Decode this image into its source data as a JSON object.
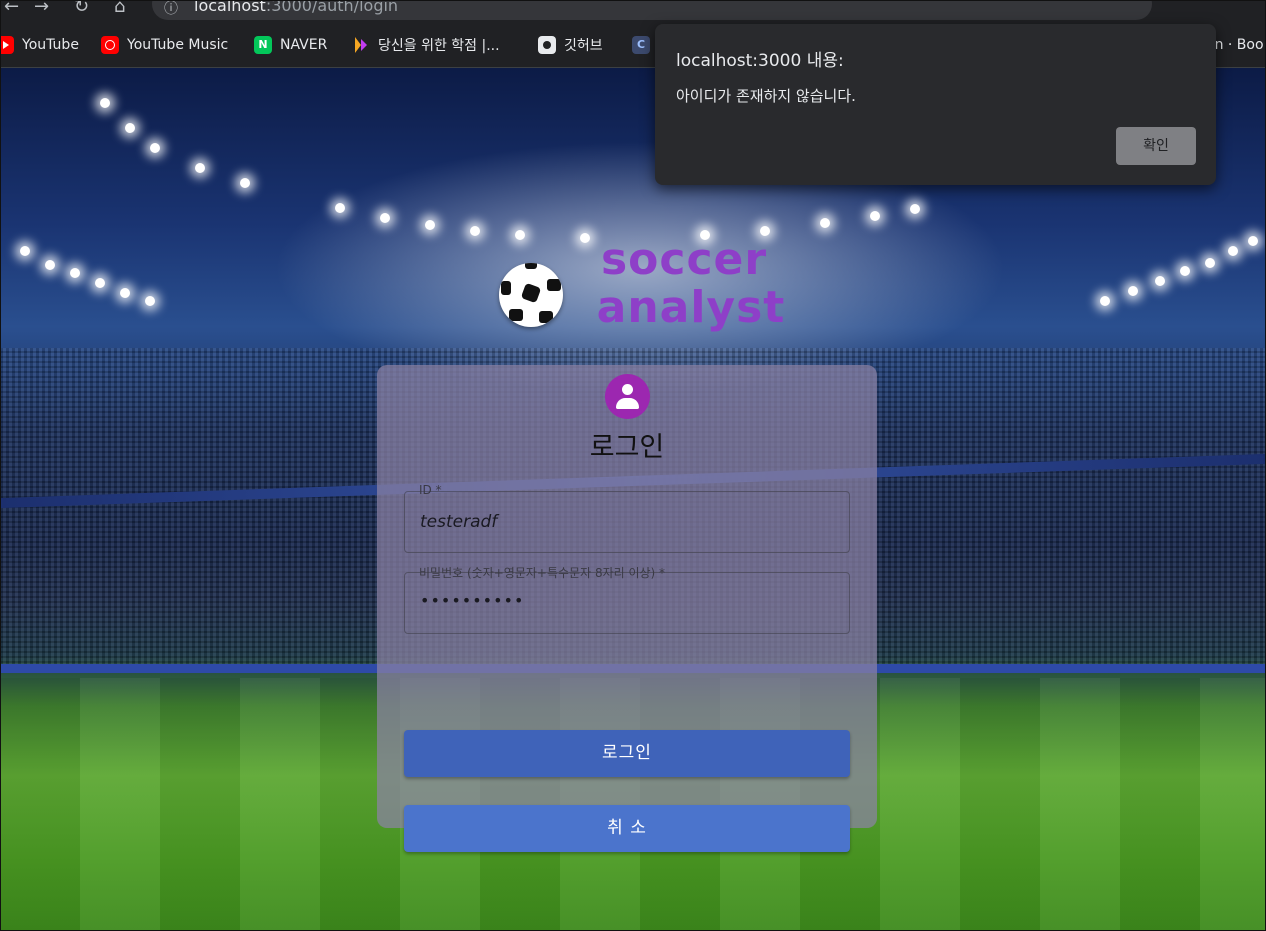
{
  "browser": {
    "url_host": "localhost",
    "url_path": ":3000/auth/login",
    "nav": {
      "back": "←",
      "forward": "→",
      "reload": "↻",
      "home": "⌂",
      "info": "ⓘ"
    },
    "bookmarks": [
      {
        "label": "YouTube",
        "icon": "youtube-icon"
      },
      {
        "label": "YouTube Music",
        "icon": "youtube-music-icon"
      },
      {
        "label": "NAVER",
        "icon": "naver-icon",
        "glyph": "N"
      },
      {
        "label": "당신을 위한 학점 |...",
        "icon": "hakjeom-icon"
      },
      {
        "label": "깃허브",
        "icon": "github-icon"
      },
      {
        "label": "",
        "icon": "c-icon",
        "glyph": "C"
      },
      {
        "label": "on · Boo",
        "icon": ""
      }
    ]
  },
  "logo": {
    "line1": "soccer",
    "line2": "analyst",
    "color": "#8e3fc8"
  },
  "login": {
    "title": "로그인",
    "id_label": "ID *",
    "id_value": "testeradf",
    "password_label": "비밀번호 (숫자+영문자+특수문자 8자리 이상) *",
    "password_mask": "••••••••••",
    "login_button": "로그인",
    "cancel_button": "취 소",
    "accent": "#9c27b0",
    "button_color": "#3f63b9"
  },
  "dialog": {
    "title": "localhost:3000 내용:",
    "message": "아이디가 존재하지 않습니다.",
    "ok_button": "확인"
  }
}
